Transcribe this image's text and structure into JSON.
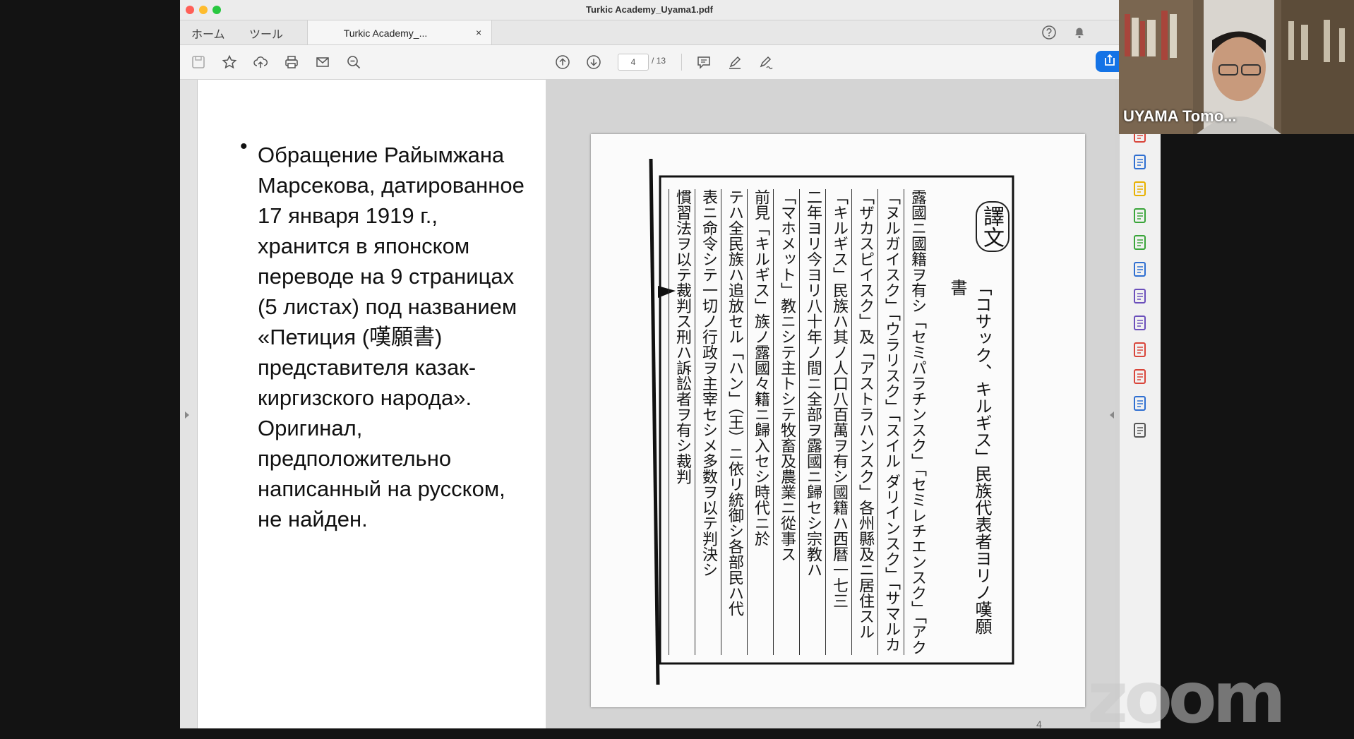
{
  "window": {
    "title": "Turkic Academy_Uyama1.pdf",
    "nav_tabs": [
      "ホーム",
      "ツール"
    ],
    "doc_tab_label": "Turkic Academy_...",
    "doc_tab_close": "×"
  },
  "toolbar": {
    "page_current": "4",
    "page_total": "/ 13",
    "left_icons": [
      "save-icon",
      "star-icon",
      "cloud-upload-icon",
      "print-icon",
      "mail-icon",
      "zoom-out-icon"
    ],
    "nav_icons": [
      "page-up-icon",
      "page-down-icon"
    ],
    "tool_icons": [
      "comment-icon",
      "highlight-pen-icon",
      "sign-icon"
    ],
    "right_icons": [
      "help-icon",
      "bell-icon"
    ]
  },
  "slide": {
    "bullet": "•",
    "body": "Обращение Райымжана Марсекова, датированное 17 января 1919 г., хранится в японском переводе на 9 страницах (5 листах) под названием «Петиция (嘆願書) представителя казак-киргизского народа». Оригинал, предположительно написанный на русском, не найден.",
    "page_number": "4"
  },
  "scan": {
    "heading": "譯文",
    "title_line": "「コサック、キルギス」民族代表者ヨリノ嘆願書",
    "columns": [
      "露國ニ國籍ヲ有シ「セミパラチンスク」「セミレチエンスク」「アクモリンスク」",
      "「ヌルガイスク」「ウラリスク」「スイル ダリインスク」「サマルカンドスク」「ヘルガンスク」",
      "「ザカスピイスク」及「アストラハンスク」各州縣及ニ居住スル「コサック」",
      "「キルギス」民族ハ其ノ人口八百萬ヲ有シ國籍ハ西暦一七三",
      "二年ヨリ今ヨリ八十年ノ間ニ全部ヲ露國ニ歸セシ宗教ハ",
      "「マホメット」教ニシテ主トシテ牧畜及農業ニ從事ス",
      "前見「キルギス」族ノ露國々籍ニ歸入セシ時代ニ於",
      "テハ全民族ハ追放セル「ハン」（王）ニ依リ統御シ各部民ハ代",
      "表ニ命令シテ一切ノ行政ヲ主宰セシメ多数ヲ以テ判決シ",
      "慣習法ヲ以テ裁判ス刑ハ訴訟者ヲ有シ裁判"
    ]
  },
  "right_panel": {
    "icons": [
      "export-pdf-icon",
      "organize-pages-icon",
      "create-pdf-icon",
      "comment-icon",
      "edit-pdf-icon",
      "print-production-icon",
      "protect-icon",
      "fill-sign-icon",
      "more-tools-icon",
      "redact-icon",
      "request-signature-icon",
      "compress-icon",
      "customize-tools-icon"
    ]
  },
  "webcam": {
    "participant_name": "UYAMA Tomo..."
  },
  "overlay": {
    "logo": "zoom"
  },
  "colors": {
    "share_button": "#1473e6",
    "toolbar_bg": "#f4f4f4",
    "viewer_bg": "#d3d3d3"
  }
}
